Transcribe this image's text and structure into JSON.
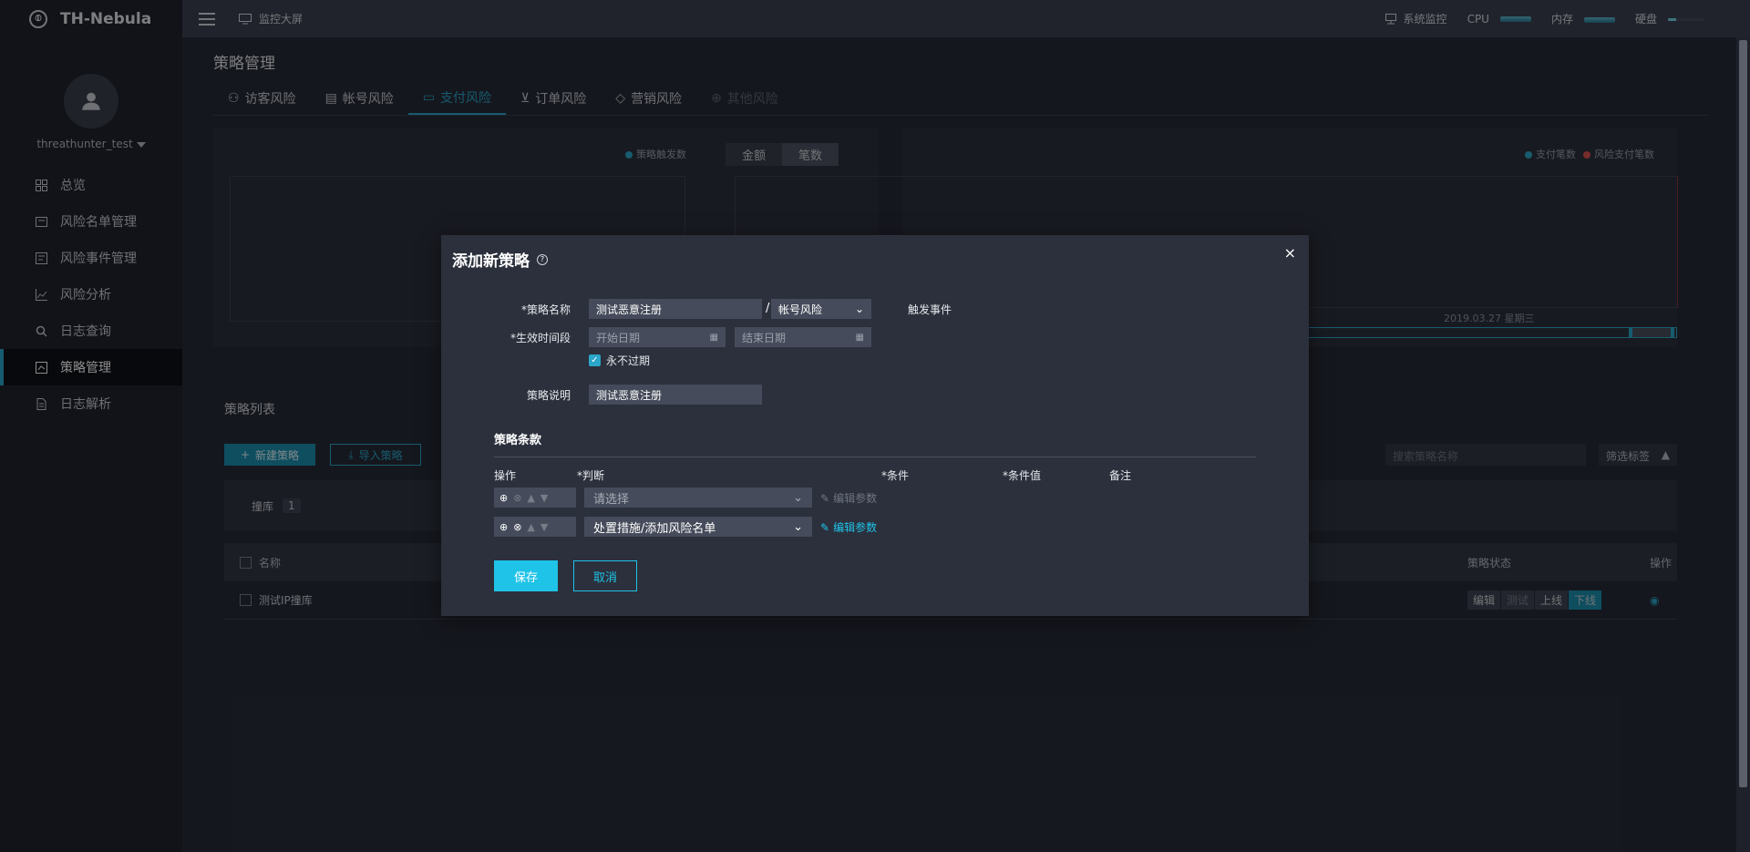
{
  "app": {
    "name": "TH-Nebula",
    "user": "threathunter_test"
  },
  "topbar": {
    "monitor": "监控大屏",
    "system_monitor": "系统监控",
    "cpu": "CPU",
    "memory": "内存",
    "disk": "硬盘"
  },
  "sidebar": {
    "items": [
      {
        "label": "总览",
        "icon": "grid-icon"
      },
      {
        "label": "风险名单管理",
        "icon": "list-icon"
      },
      {
        "label": "风险事件管理",
        "icon": "event-icon"
      },
      {
        "label": "风险分析",
        "icon": "chart-icon"
      },
      {
        "label": "日志查询",
        "icon": "search-icon"
      },
      {
        "label": "策略管理",
        "icon": "policy-icon",
        "active": true
      },
      {
        "label": "日志解析",
        "icon": "doc-icon"
      }
    ]
  },
  "main": {
    "title": "策略管理",
    "tabs": [
      {
        "label": "访客风险"
      },
      {
        "label": "帐号风险"
      },
      {
        "label": "支付风险",
        "active": true
      },
      {
        "label": "订单风险"
      },
      {
        "label": "营销风险"
      },
      {
        "label": "其他风险",
        "disabled": true
      }
    ],
    "legend_left": "策略触发数",
    "segment": [
      "金额",
      "笔数"
    ],
    "legend_right": [
      "支付笔数",
      "风险支付笔数"
    ],
    "chart_date": "2019.03.27 星期三",
    "list_title": "策略列表",
    "new_btn": "新建策略",
    "import_btn": "导入策略",
    "search_placeholder": "搜索策略名称",
    "filter_tag": "筛选标签",
    "category": "撞库",
    "category_count": "1",
    "table": {
      "headers": {
        "name": "名称",
        "status": "策略状态",
        "ops": "操作"
      },
      "rows": [
        {
          "name": "测试IP撞库"
        }
      ],
      "op_buttons": [
        "编辑",
        "测试",
        "上线",
        "下线"
      ]
    }
  },
  "modal": {
    "title": "添加新策略",
    "close": "×",
    "name_label": "*策略名称",
    "name_value": "测试恶意注册",
    "slash": "/",
    "category_value": "帐号风险",
    "trigger_label": "触发事件",
    "period_label": "*生效时间段",
    "start_placeholder": "开始日期",
    "end_placeholder": "结束日期",
    "never_expire": "永不过期",
    "desc_label": "策略说明",
    "desc_value": "测试恶意注册",
    "clause_title": "策略条款",
    "columns": {
      "op": "操作",
      "judge": "*判断",
      "cond": "*条件",
      "cond_value": "*条件值",
      "note": "备注"
    },
    "rows": [
      {
        "select": "请选择",
        "edit": "编辑参数",
        "placeholder": true
      },
      {
        "select": "处置措施/添加风险名单",
        "edit": "编辑参数",
        "placeholder": false
      }
    ],
    "save": "保存",
    "cancel": "取消"
  }
}
